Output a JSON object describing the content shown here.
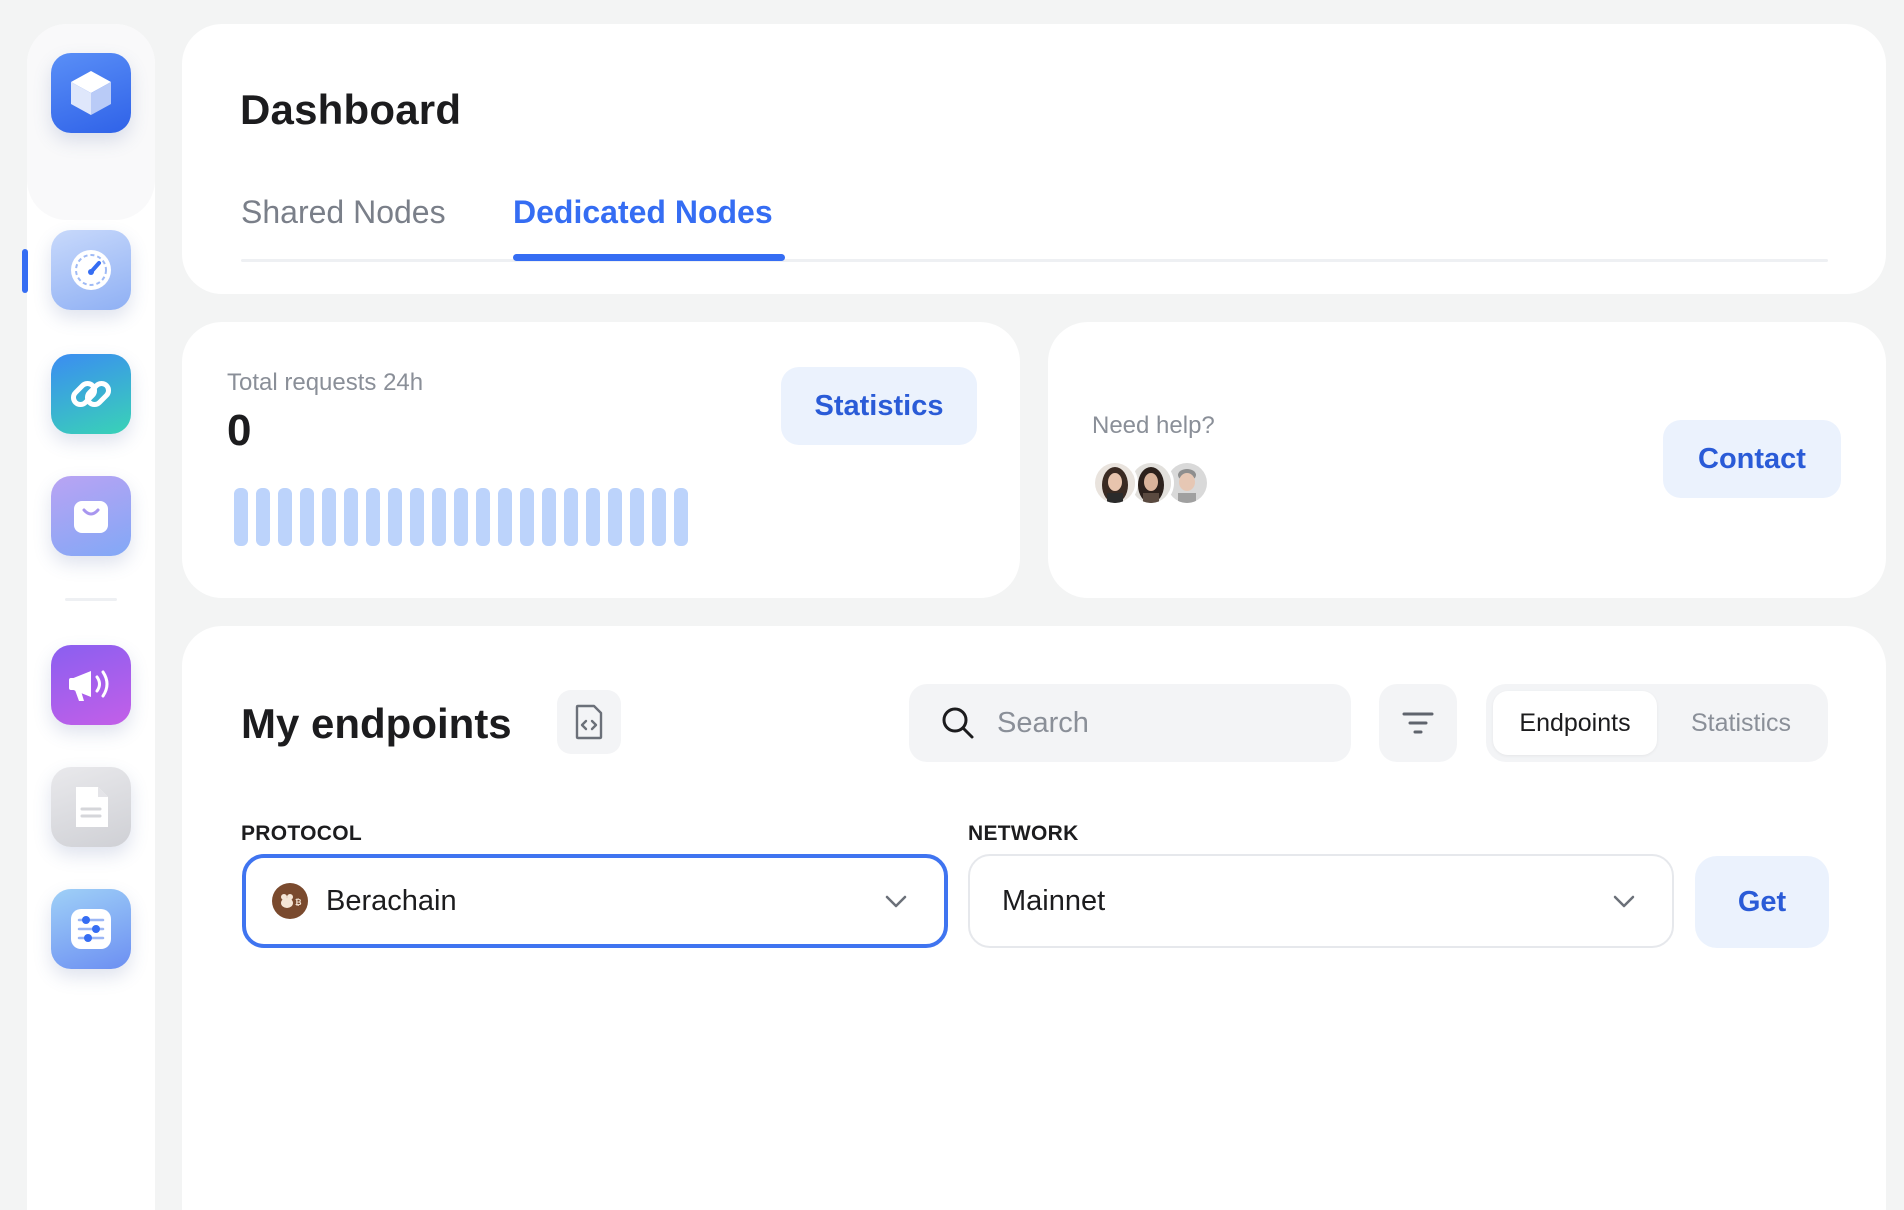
{
  "sidebar": {
    "icons": [
      "cube-logo-icon",
      "speedometer-icon",
      "link-icon",
      "bag-icon",
      "megaphone-icon",
      "document-icon",
      "sliders-icon"
    ],
    "colors": {
      "active": "#356df3"
    }
  },
  "header": {
    "title": "Dashboard",
    "tabs": [
      {
        "label": "Shared Nodes",
        "active": false
      },
      {
        "label": "Dedicated Nodes",
        "active": true
      }
    ]
  },
  "requests": {
    "label": "Total requests 24h",
    "value": "0",
    "bar_count": 21,
    "statistics_button": "Statistics"
  },
  "help": {
    "label": "Need help?",
    "contact_button": "Contact"
  },
  "endpoints": {
    "title": "My endpoints",
    "search_placeholder": "Search",
    "segments": [
      {
        "label": "Endpoints",
        "active": true
      },
      {
        "label": "Statistics",
        "active": false
      }
    ],
    "protocol_label": "PROTOCOL",
    "protocol_value": "Berachain",
    "network_label": "NETWORK",
    "network_value": "Mainnet",
    "get_button": "Get"
  }
}
